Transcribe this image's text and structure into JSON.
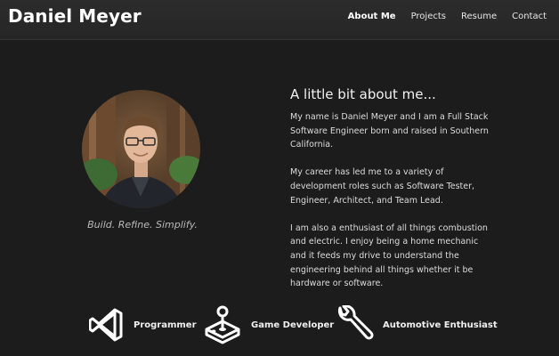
{
  "header": {
    "brand": "Daniel Meyer",
    "nav": [
      {
        "label": "About Me",
        "active": true
      },
      {
        "label": "Projects",
        "active": false
      },
      {
        "label": "Resume",
        "active": false
      },
      {
        "label": "Contact",
        "active": false
      }
    ]
  },
  "profile": {
    "tagline": "Build. Refine. Simplify."
  },
  "about": {
    "heading": "A little bit about me...",
    "paragraphs": [
      "My name is Daniel Meyer and I am a Full Stack Software Engineer born and raised in Southern California.",
      "My career has led me to a variety of development roles such as Software Tester, Engineer, Architect, and Team Lead.",
      "I am also a enthusiast of all things combustion and electric. I enjoy being a home mechanic and it feeds my drive to understand the engineering behind all things whether it be hardware or software."
    ]
  },
  "skills": [
    {
      "label": "Programmer",
      "icon": "vscode-icon"
    },
    {
      "label": "Game Developer",
      "icon": "joystick-icon"
    },
    {
      "label": "Automotive Enthusiast",
      "icon": "wrench-icon"
    }
  ],
  "colors": {
    "background": "#1c1c1c",
    "header": "#2a2a2a",
    "text": "#e8e8e8",
    "muted": "#b9b9b9"
  }
}
